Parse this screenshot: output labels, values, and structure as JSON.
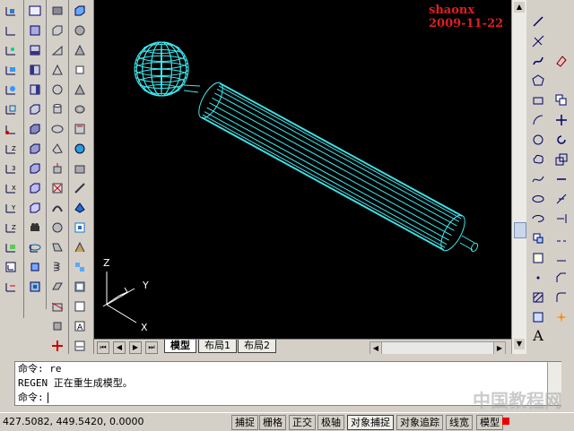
{
  "watermark": "shaonx 2009-11-22",
  "site_mark": "中国教程网",
  "ucs": {
    "z": "Z",
    "y": "Y",
    "x": "X"
  },
  "tabs": [
    "模型",
    "布局1",
    "布局2"
  ],
  "nav_buttons": [
    "⏮",
    "◀",
    "▶",
    "⏭"
  ],
  "command_lines": [
    "命令: re",
    "REGEN 正在重生成模型。",
    "命令:"
  ],
  "status": {
    "coords": "427.5082, 449.5420, 0.0000",
    "modes": [
      "捕捉",
      "栅格",
      "正交",
      "极轴",
      "对象捕捉",
      "对象追踪",
      "线宽",
      "模型"
    ]
  },
  "draw_bottom_label": "A",
  "colors": {
    "wire": "#3fe8ee",
    "watermark": "#e01f1f",
    "canvas": "#000000"
  }
}
